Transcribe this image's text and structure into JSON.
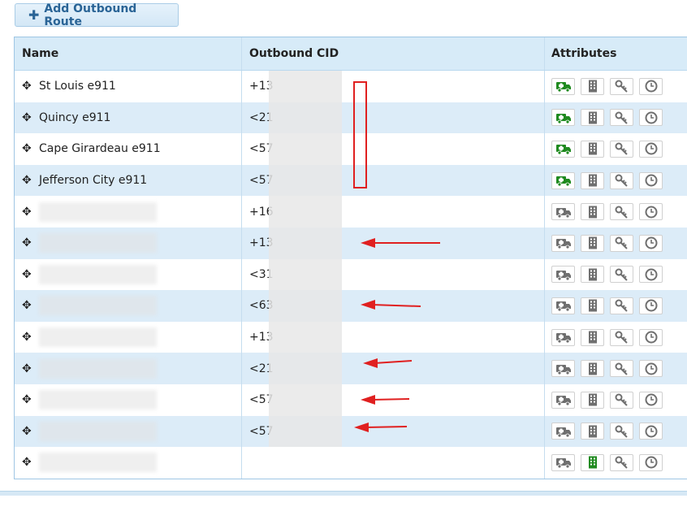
{
  "toolbar": {
    "add_label": "Add Outbound Route"
  },
  "columns": {
    "name": "Name",
    "cid": "Outbound CID",
    "attributes": "Attributes"
  },
  "rows": [
    {
      "name": "St Louis e911",
      "cid": "+13",
      "blurred": false,
      "emergency": true,
      "intracompany": false
    },
    {
      "name": "Quincy e911",
      "cid": "<21",
      "blurred": false,
      "emergency": true,
      "intracompany": false
    },
    {
      "name": "Cape Girardeau e911",
      "cid": "<57",
      "blurred": false,
      "emergency": true,
      "intracompany": false
    },
    {
      "name": "Jefferson City e911",
      "cid": "<57",
      "blurred": false,
      "emergency": true,
      "intracompany": false
    },
    {
      "name": "",
      "cid": "+16",
      "blurred": true,
      "emergency": false,
      "intracompany": false
    },
    {
      "name": "",
      "cid": "+13",
      "blurred": true,
      "emergency": false,
      "intracompany": false
    },
    {
      "name": "",
      "cid": "<31",
      "blurred": true,
      "emergency": false,
      "intracompany": false
    },
    {
      "name": "",
      "cid": "<63",
      "blurred": true,
      "emergency": false,
      "intracompany": false
    },
    {
      "name": "",
      "cid": "+13",
      "blurred": true,
      "emergency": false,
      "intracompany": false
    },
    {
      "name": "",
      "cid": "<21",
      "blurred": true,
      "emergency": false,
      "intracompany": false
    },
    {
      "name": "",
      "cid": "<57",
      "blurred": true,
      "emergency": false,
      "intracompany": false
    },
    {
      "name": "",
      "cid": "<57",
      "blurred": true,
      "emergency": false,
      "intracompany": false
    },
    {
      "name": "",
      "cid": "",
      "blurred": true,
      "emergency": false,
      "intracompany": true
    }
  ],
  "colors": {
    "accent": "#2a6496",
    "emergency_on": "#1f8a1f",
    "icon_off": "#6f6f6f",
    "intracompany_on": "#1f8a1f",
    "annotation": "#e02020"
  },
  "icons": [
    "drag-move-icon",
    "ambulance-icon",
    "building-icon",
    "key-icon",
    "clock-icon"
  ]
}
